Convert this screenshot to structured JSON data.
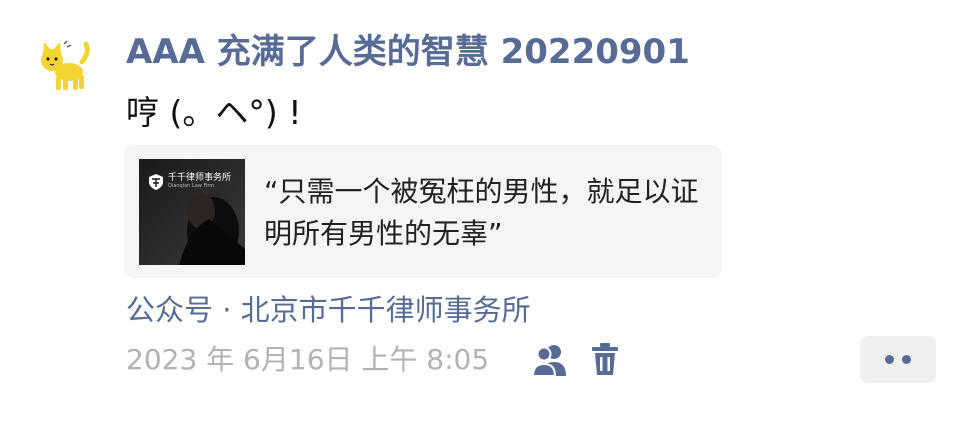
{
  "moment": {
    "author_name": "AAA 充满了人类的智慧 20220901",
    "text": "哼 (。ヘ°) !",
    "link_card": {
      "title": "“只需一个被冤枉的男性，就足以证明所有男性的无辜”",
      "thumbnail_firm_name": "千千律师事务所",
      "thumbnail_firm_en": "Qianqian Law Firm"
    },
    "source": "公众号 · 北京市千千律师事务所",
    "timestamp": "2023 年 6月16日 上午 8:05"
  },
  "icons": {
    "avatar": "yellow-cat-avatar",
    "visibility": "people-icon",
    "delete": "trash-icon",
    "more": "more-dots-icon"
  },
  "colors": {
    "link_blue": "#576b95",
    "time_gray": "#b2b2b2",
    "card_bg": "#f5f5f5"
  }
}
